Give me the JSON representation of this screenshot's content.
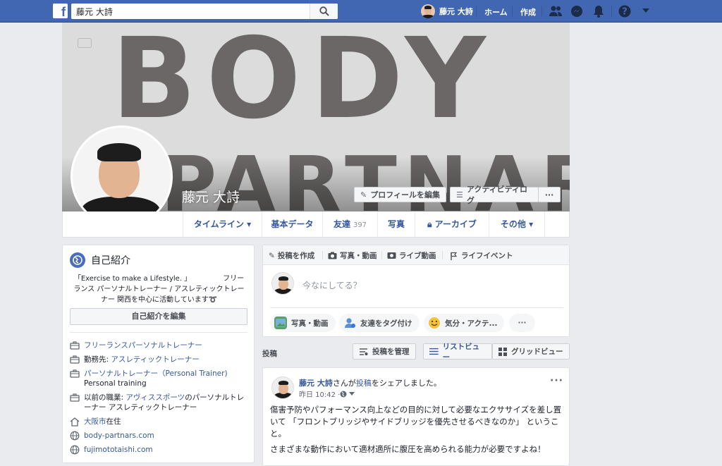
{
  "topbar": {
    "logo": "f",
    "search_value": "藤元 大詩",
    "user_name": "藤元 大詩",
    "home": "ホーム",
    "create": "作成",
    "icons": [
      "friends-icon",
      "messenger-icon",
      "bell-icon",
      "help-icon",
      "caret-down-icon"
    ]
  },
  "cover": {
    "line1": "BODY",
    "line2": "PARTNARS",
    "name": "藤元 大詩",
    "edit_profile": "プロフィールを編集",
    "activity_log": "アクティビティログ",
    "more": "···"
  },
  "tabs": [
    {
      "label": "タイムライン ▾"
    },
    {
      "label": "基本データ"
    },
    {
      "label": "友達",
      "count": "397"
    },
    {
      "label": "写真"
    },
    {
      "label": "アーカイブ"
    },
    {
      "label": "その他 ▾"
    }
  ],
  "intro": {
    "title": "自己紹介",
    "bio": "「Exercise to make a Lifestyle. 」　　　　　フリーランス パーソナルトレーナー / アスレティックトレーナー 関西を中心に活動しています➰",
    "edit_bio": "自己紹介を編集",
    "items": [
      {
        "link": "フリーランスパーソナルトレーナー",
        "plain": ""
      },
      {
        "pre": "勤務先: ",
        "link": "アスレティックトレーナー"
      },
      {
        "link": "パーソナルトレーナー（Personal Trainer)",
        "sub": "Personal training"
      },
      {
        "pre": "以前の職業: ",
        "link": "アヴィススポーツ",
        "post": "のパーソナルトレーナー アスレティックトレーナー"
      },
      {
        "link": "大阪市",
        "post": "在住"
      },
      {
        "link": "body-partnars.com"
      },
      {
        "link": "fujimototaishi.com"
      }
    ]
  },
  "composer": {
    "head": [
      "投稿を作成",
      "写真・動画",
      "ライブ動画",
      "ライフイベント"
    ],
    "placeholder": "今なにしてる？",
    "pills": [
      "写真・動画",
      "友達をタグ付け",
      "気分・アクテ...",
      "···"
    ]
  },
  "posts_bar": {
    "label": "投稿",
    "manage": "投稿を管理",
    "list_view": "リストビュー",
    "grid_view": "グリッドビュー"
  },
  "post": {
    "author": "藤元 大詩",
    "action_pre": "さんが",
    "action_link": "投稿",
    "action_post": "をシェアしました。",
    "time": "昨日 10:42 · ",
    "more": "···",
    "para1": "傷害予防やパフォーマンス向上などの目的に対して必要なエクササイズを差し置いて 「フロントブリッジやサイドブリッジを優先させるべきなのか」 ということ。",
    "para2": "さまざまな動作において適材適所に腹圧を高められる能力が必要ですよね！"
  }
}
